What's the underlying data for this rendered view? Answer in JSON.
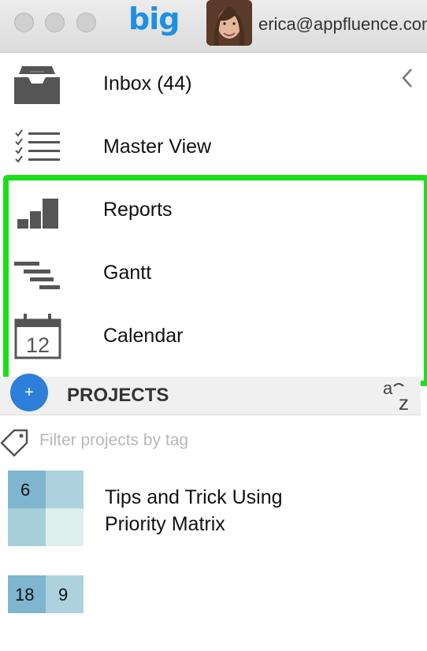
{
  "titlebar": {
    "logo": "big",
    "user_email": "erica@appfluence.com"
  },
  "nav": {
    "items": [
      {
        "label": "Inbox (44)",
        "icon": "inbox-icon"
      },
      {
        "label": "Master View",
        "icon": "checklist-icon"
      },
      {
        "label": "Reports",
        "icon": "bar-chart-icon"
      },
      {
        "label": "Gantt",
        "icon": "gantt-icon"
      },
      {
        "label": "Calendar",
        "icon": "calendar-icon"
      }
    ],
    "calendar_day": "12",
    "collapse_icon": "chevron-left-icon"
  },
  "projects": {
    "title": "PROJECTS",
    "add_label": "+",
    "sort_icon": "sort-az-icon",
    "sort_text_top": "a",
    "sort_text_bottom": "z",
    "filter_placeholder": "Filter projects by tag",
    "items": [
      {
        "name": "Tips and Trick Using Priority Matrix",
        "counts": [
          "6",
          "",
          "",
          ""
        ]
      },
      {
        "name": "",
        "counts": [
          "18",
          "9",
          "",
          ""
        ]
      }
    ]
  },
  "colors": {
    "highlight": "#19e019",
    "accent": "#2d7fd9",
    "logo": "#1f8fe3",
    "q1": "#7fb5cf",
    "q2": "#aed1de",
    "q3": "#a7cfd9",
    "q4": "#deeeed"
  }
}
